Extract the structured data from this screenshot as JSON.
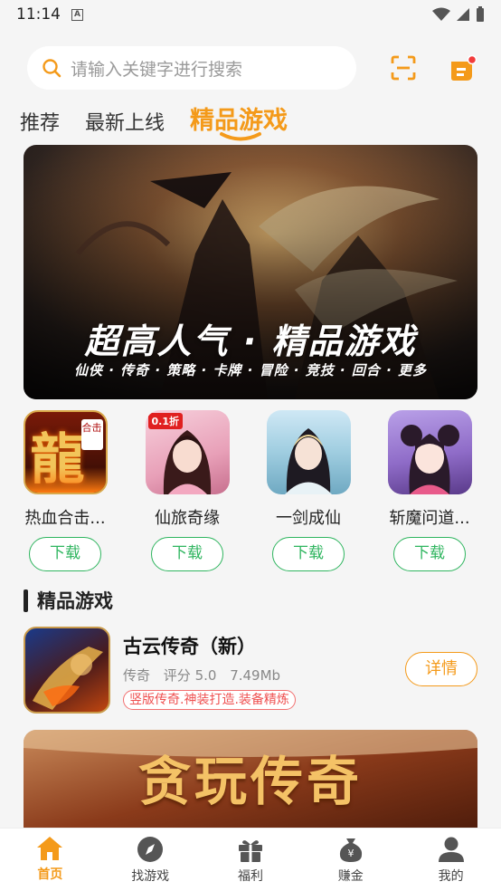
{
  "status": {
    "time": "11:14",
    "a_badge": "A"
  },
  "search": {
    "placeholder": "请输入关键字进行搜索"
  },
  "tabs": [
    {
      "label": "推荐",
      "active": false
    },
    {
      "label": "最新上线",
      "active": false
    },
    {
      "label": "精品游戏",
      "active": true
    }
  ],
  "banner": {
    "title": "超高人气 · 精品游戏",
    "subtitle": "仙侠 · 传奇 · 策略 · 卡牌 · 冒险 · 竞技 · 回合 · 更多"
  },
  "games": [
    {
      "name": "热血合击...",
      "button": "下载",
      "icon_text": "龍",
      "icon_badge": "合击"
    },
    {
      "name": "仙旅奇缘",
      "button": "下载",
      "icon_badge": "0.1折"
    },
    {
      "name": "一剑成仙",
      "button": "下载"
    },
    {
      "name": "斩魔问道...",
      "button": "下载"
    }
  ],
  "section": {
    "title": "精品游戏"
  },
  "featured": {
    "name": "古云传奇（新）",
    "genre": "传奇",
    "rating": "评分 5.0",
    "size": "7.49Mb",
    "tag": "竖版传奇.神装打造.装备精炼",
    "button": "详情"
  },
  "promo": {
    "text": "贪玩传奇"
  },
  "nav": [
    {
      "label": "首页",
      "icon": "home-icon",
      "active": true
    },
    {
      "label": "找游戏",
      "icon": "compass-icon",
      "active": false
    },
    {
      "label": "福利",
      "icon": "gift-icon",
      "active": false
    },
    {
      "label": "赚金",
      "icon": "money-bag-icon",
      "active": false
    },
    {
      "label": "我的",
      "icon": "user-icon",
      "active": false
    }
  ],
  "colors": {
    "accent": "#f49a1a",
    "download_green": "#2fb55f",
    "tag_red": "#ef5050"
  }
}
